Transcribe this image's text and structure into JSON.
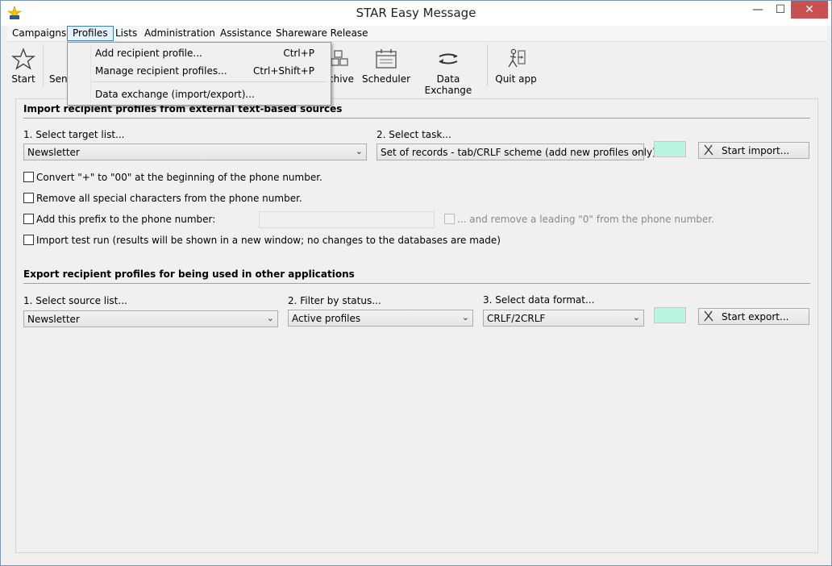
{
  "window": {
    "title": "STAR Easy Message",
    "controls": {
      "minimize": "—",
      "maximize": "☐",
      "close": "✕"
    }
  },
  "menu": {
    "items": [
      "Campaigns",
      "Profiles",
      "Lists",
      "Administration",
      "Assistance",
      "Shareware Release"
    ],
    "active_index": 1
  },
  "profiles_menu": {
    "items": [
      {
        "label": "Add recipient profile...",
        "shortcut": "Ctrl+P"
      },
      {
        "label": "Manage recipient profiles...",
        "shortcut": "Ctrl+Shift+P"
      },
      {
        "label": "Data exchange (import/export)...",
        "shortcut": ""
      }
    ]
  },
  "toolbar": {
    "start": "Start",
    "send_partial": "Sen",
    "archive_partial": "chive",
    "scheduler": "Scheduler",
    "data_exchange": "Data Exchange",
    "quit": "Quit app"
  },
  "import": {
    "section_title": "Import recipient profiles from external text-based sources",
    "target_label": "1. Select target list...",
    "target_value": "Newsletter",
    "task_label": "2. Select task...",
    "task_value": "Set of records - tab/CRLF scheme (add new profiles only)",
    "start_button": "Start import...",
    "options": [
      "Convert \"+\" to \"00\" at the beginning of the phone number.",
      "Remove all special characters from the phone number.",
      "Add this prefix to the phone number:",
      "Import test run (results will be shown in a new window; no changes to the databases are made)"
    ],
    "prefix_value": "",
    "remove_zero_label": "... and remove a leading \"0\" from the phone number."
  },
  "export": {
    "section_title": "Export recipient profiles for being used in other applications",
    "source_label": "1. Select source list...",
    "source_value": "Newsletter",
    "filter_label": "2. Filter by status...",
    "filter_value": "Active profiles",
    "format_label": "3. Select data format...",
    "format_value": "CRLF/2CRLF",
    "start_button": "Start export..."
  },
  "colors": {
    "swatch": "#b8f5e0",
    "menu_active_border": "#3c7fb1",
    "close_button": "#c75050"
  }
}
